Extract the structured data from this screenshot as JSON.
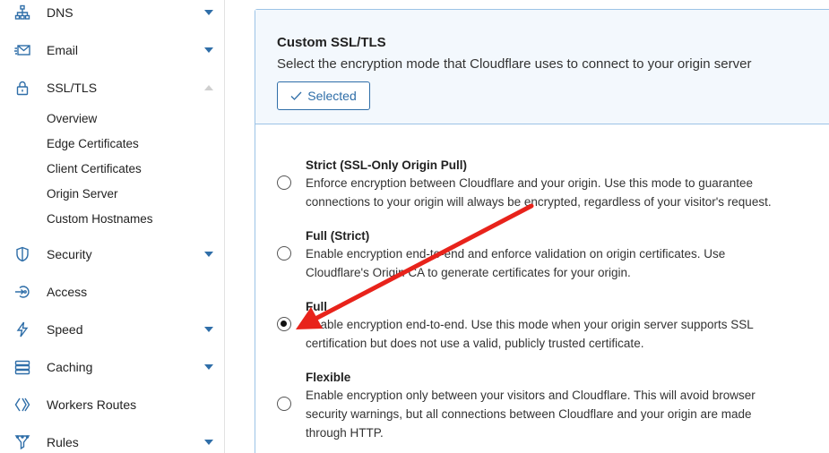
{
  "sidebar": {
    "items": [
      {
        "label": "DNS",
        "icon": "network-icon"
      },
      {
        "label": "Email",
        "icon": "email-icon"
      },
      {
        "label": "SSL/TLS",
        "icon": "lock-icon"
      },
      {
        "label": "Security",
        "icon": "shield-icon"
      },
      {
        "label": "Access",
        "icon": "access-icon"
      },
      {
        "label": "Speed",
        "icon": "bolt-icon"
      },
      {
        "label": "Caching",
        "icon": "stack-icon"
      },
      {
        "label": "Workers Routes",
        "icon": "workers-icon"
      },
      {
        "label": "Rules",
        "icon": "rules-icon"
      }
    ],
    "ssl_subitems": [
      "Overview",
      "Edge Certificates",
      "Client Certificates",
      "Origin Server",
      "Custom Hostnames"
    ]
  },
  "panel": {
    "title": "Custom SSL/TLS",
    "description": "Select the encryption mode that Cloudflare uses to connect to your origin server",
    "selected_button": "Selected",
    "options": [
      {
        "title": "Strict (SSL-Only Origin Pull)",
        "line1": "Enforce encryption between Cloudflare and your origin. Use this mode to guarantee",
        "line2": "connections to your origin will always be encrypted, regardless of your visitor's request.",
        "line3": "",
        "checked": false
      },
      {
        "title": "Full (Strict)",
        "line1": "Enable encryption end-to-end and enforce validation on origin certificates. Use",
        "line2": "Cloudflare's Origin CA to generate certificates for your origin.",
        "line3": "",
        "checked": false
      },
      {
        "title": "Full",
        "line1": "Enable encryption end-to-end. Use this mode when your origin server supports SSL",
        "line2": "certification but does not use a valid, publicly trusted certificate.",
        "line3": "",
        "checked": true
      },
      {
        "title": "Flexible",
        "line1": "Enable encryption only between your visitors and Cloudflare. This will avoid browser",
        "line2": "security warnings, but all connections between Cloudflare and your origin are made",
        "line3": "through HTTP.",
        "checked": false
      }
    ]
  },
  "colors": {
    "accent": "#2f6ea8",
    "panel_border": "#9cc3e6",
    "header_bg": "#f3f8fd",
    "annotation_arrow": "#e8231b"
  }
}
